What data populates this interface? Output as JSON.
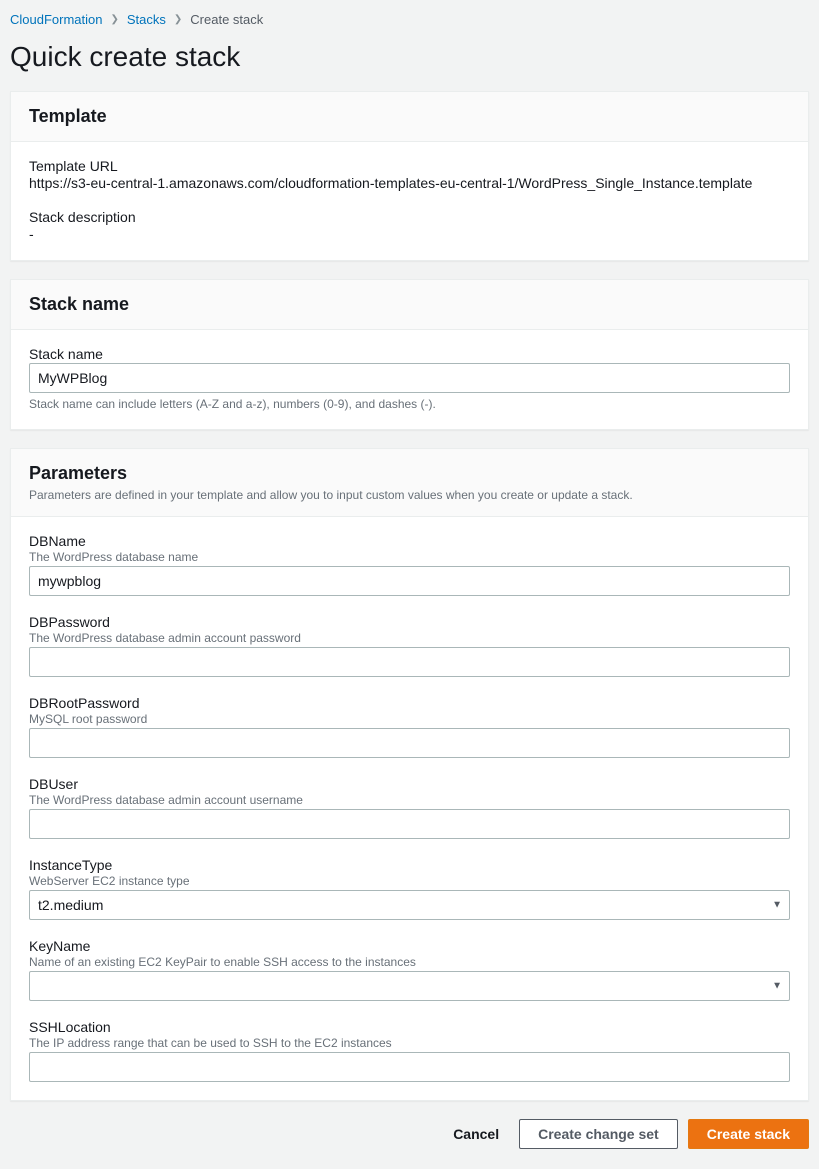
{
  "breadcrumb": {
    "root": "CloudFormation",
    "stacks": "Stacks",
    "current": "Create stack"
  },
  "page_title": "Quick create stack",
  "template_panel": {
    "title": "Template",
    "url_label": "Template URL",
    "url_value": "https://s3-eu-central-1.amazonaws.com/cloudformation-templates-eu-central-1/WordPress_Single_Instance.template",
    "desc_label": "Stack description",
    "desc_value": "-"
  },
  "stackname_panel": {
    "title": "Stack name",
    "label": "Stack name",
    "value": "MyWPBlog",
    "hint": "Stack name can include letters (A-Z and a-z), numbers (0-9), and dashes (-)."
  },
  "parameters_panel": {
    "title": "Parameters",
    "desc": "Parameters are defined in your template and allow you to input custom values when you create or update a stack.",
    "dbname": {
      "label": "DBName",
      "desc": "The WordPress database name",
      "value": "mywpblog"
    },
    "dbpassword": {
      "label": "DBPassword",
      "desc": "The WordPress database admin account password",
      "value": ""
    },
    "dbrootpassword": {
      "label": "DBRootPassword",
      "desc": "MySQL root password",
      "value": ""
    },
    "dbuser": {
      "label": "DBUser",
      "desc": "The WordPress database admin account username",
      "value": ""
    },
    "instancetype": {
      "label": "InstanceType",
      "desc": "WebServer EC2 instance type",
      "value": "t2.medium"
    },
    "keyname": {
      "label": "KeyName",
      "desc": "Name of an existing EC2 KeyPair to enable SSH access to the instances",
      "value": ""
    },
    "sshlocation": {
      "label": "SSHLocation",
      "desc": "The IP address range that can be used to SSH to the EC2 instances",
      "value": ""
    }
  },
  "footer": {
    "cancel": "Cancel",
    "create_changeset": "Create change set",
    "create_stack": "Create stack"
  }
}
